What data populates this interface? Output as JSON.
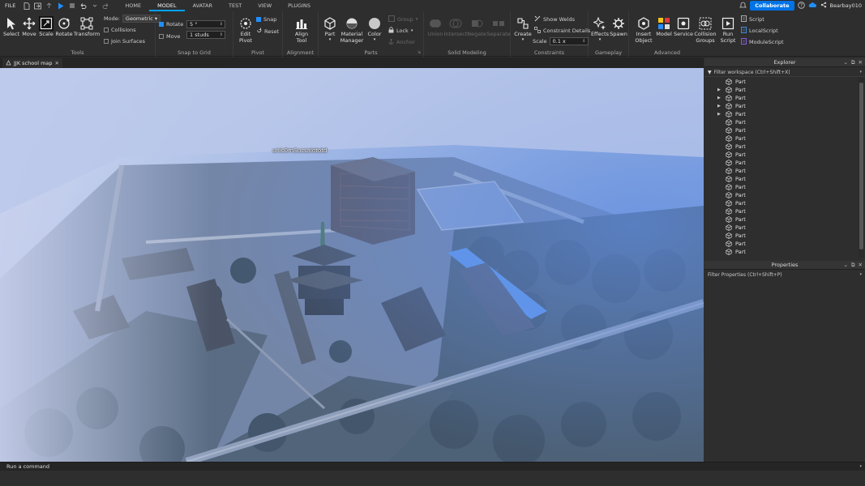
{
  "menubar": {
    "file": "FILE",
    "tabs": [
      "HOME",
      "MODEL",
      "AVATAR",
      "TEST",
      "VIEW",
      "PLUGINS"
    ],
    "active_tab": "MODEL",
    "collaborate": "Collaborate",
    "username": "Bearbay010"
  },
  "ribbon": {
    "tools": {
      "label": "Tools",
      "select": "Select",
      "move": "Move",
      "scale": "Scale",
      "rotate": "Rotate",
      "transform": "Transform",
      "mode_label": "Mode:",
      "mode_value": "Geometric",
      "collisions": "Collisions",
      "join_surfaces": "Join Surfaces"
    },
    "snap": {
      "label": "Snap to Grid",
      "rotate": "Rotate",
      "rotate_value": "5 °",
      "move": "Move",
      "move_value": "1 studs"
    },
    "pivot": {
      "label": "Pivot",
      "edit_pivot_1": "Edit",
      "edit_pivot_2": "Pivot",
      "snap": "Snap",
      "reset": "Reset"
    },
    "alignment": {
      "label": "Alignment",
      "align_1": "Align",
      "align_2": "Tool"
    },
    "parts": {
      "label": "Parts",
      "part": "Part",
      "material_1": "Material",
      "material_2": "Manager",
      "color": "Color",
      "group": "Group",
      "lock": "Lock",
      "anchor": "Anchor"
    },
    "solid": {
      "label": "Solid Modeling",
      "union": "Union",
      "intersect": "Intersect",
      "negate": "Negate",
      "separate": "Separate"
    },
    "constraints": {
      "label": "Constraints",
      "create": "Create",
      "show_welds": "Show Welds",
      "constraint_details": "Constraint Details",
      "scale": "Scale",
      "scale_value": "0.1 x"
    },
    "gameplay": {
      "label": "Gameplay",
      "effects": "Effects",
      "spawn": "Spawn"
    },
    "advanced": {
      "label": "Advanced",
      "insert_1": "Insert",
      "insert_2": "Object",
      "model": "Model",
      "service": "Service",
      "collision_1": "Collision",
      "collision_2": "Groups",
      "run_1": "Run",
      "run_2": "Script",
      "script": "Script",
      "local_script": "LocalScript",
      "module_script": "ModuleScript"
    }
  },
  "viewport": {
    "tab_title": "JJK school map",
    "player_name": "unic0rnSucsalototd"
  },
  "explorer": {
    "title": "Explorer",
    "filter_placeholder": "Filter workspace (Ctrl+Shift+X)",
    "items": [
      {
        "label": "Part",
        "expandable": false
      },
      {
        "label": "Part",
        "expandable": true
      },
      {
        "label": "Part",
        "expandable": true
      },
      {
        "label": "Part",
        "expandable": true
      },
      {
        "label": "Part",
        "expandable": true
      },
      {
        "label": "Part",
        "expandable": false
      },
      {
        "label": "Part",
        "expandable": false
      },
      {
        "label": "Part",
        "expandable": false
      },
      {
        "label": "Part",
        "expandable": false
      },
      {
        "label": "Part",
        "expandable": false
      },
      {
        "label": "Part",
        "expandable": false
      },
      {
        "label": "Part",
        "expandable": false
      },
      {
        "label": "Part",
        "expandable": false
      },
      {
        "label": "Part",
        "expandable": false
      },
      {
        "label": "Part",
        "expandable": false
      },
      {
        "label": "Part",
        "expandable": false
      },
      {
        "label": "Part",
        "expandable": false
      },
      {
        "label": "Part",
        "expandable": false
      },
      {
        "label": "Part",
        "expandable": false
      },
      {
        "label": "Part",
        "expandable": false
      },
      {
        "label": "Part",
        "expandable": false
      },
      {
        "label": "Part",
        "expandable": false
      }
    ]
  },
  "properties": {
    "title": "Properties",
    "filter_placeholder": "Filter Properties (Ctrl+Shift+P)"
  },
  "command": {
    "placeholder": "Run a command"
  },
  "colors": {
    "accent": "#00a2ff",
    "collaborate": "#0073e6",
    "panel": "#2e2e2e"
  }
}
